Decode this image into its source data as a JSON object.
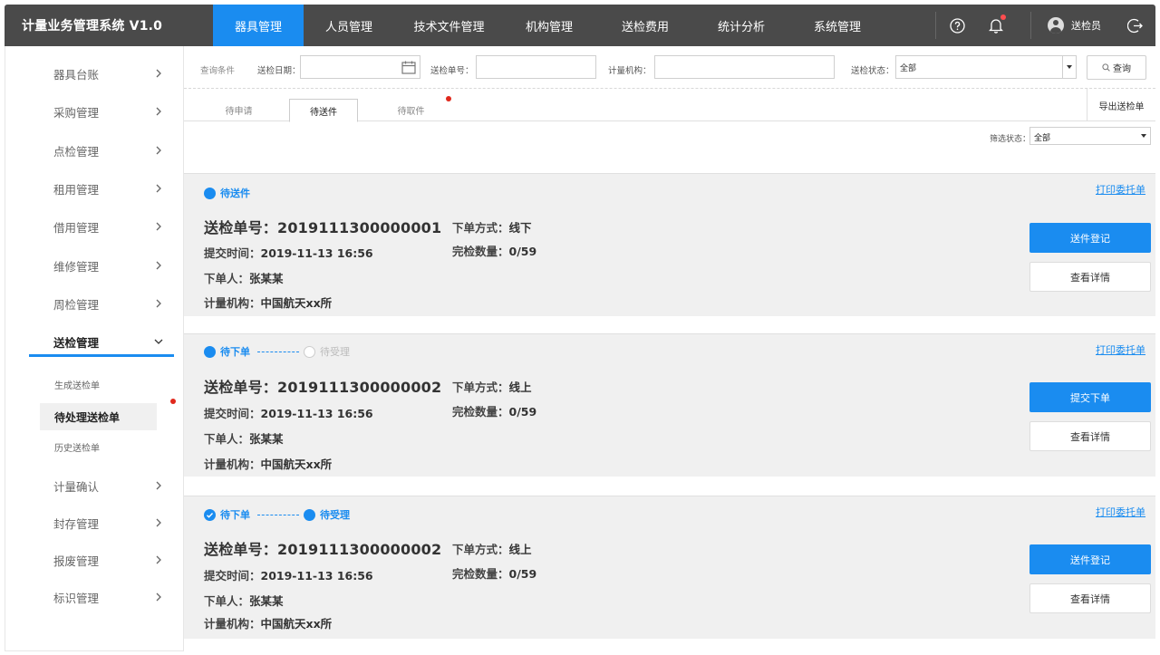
{
  "app": {
    "title": "计量业务管理系统 V1.0"
  },
  "nav": {
    "items": [
      "器具管理",
      "人员管理",
      "技术文件管理",
      "机构管理",
      "送检费用",
      "统计分析",
      "系统管理"
    ],
    "active_index": 0
  },
  "user": {
    "name": "送检员"
  },
  "sidebar": {
    "items": [
      "器具台账",
      "采购管理",
      "点检管理",
      "租用管理",
      "借用管理",
      "维修管理",
      "周检管理",
      "送检管理",
      "计量确认",
      "封存管理",
      "报废管理",
      "标识管理"
    ],
    "open_index": 7,
    "sub_items": [
      "生成送检单",
      "待处理送检单",
      "历史送检单"
    ],
    "active_sub_index": 1
  },
  "filters": {
    "section_label": "查询条件",
    "date_label": "送检日期：",
    "date_value": "",
    "order_no_label": "送检单号：",
    "order_no_value": "",
    "org_label": "计量机构：",
    "org_value": "",
    "status_label": "送检状态：",
    "status_value": "全部",
    "query_button": "查询"
  },
  "tabs": {
    "items": [
      "待申请",
      "待送件",
      "待取件"
    ],
    "active_index": 1,
    "export_button": "导出送检单"
  },
  "filter_status": {
    "label": "筛选状态：",
    "value": "全部"
  },
  "cards": [
    {
      "status_steps": [
        {
          "label": "待送件",
          "state": "active"
        }
      ],
      "print_link": "打印委托单",
      "order_no_label": "送检单号：",
      "order_no": "2019111300000001",
      "submit_label": "提交时间：",
      "submit_time": "2019-11-13 16:56",
      "owner_label": "下单人：",
      "owner": "张某某",
      "org_label": "计量机构：",
      "org": "中国航天xx所",
      "method_label": "下单方式：",
      "method": "线下",
      "count_label": "完检数量：",
      "count": "0/59",
      "primary_button": "送件登记",
      "detail_button": "查看详情"
    },
    {
      "status_steps": [
        {
          "label": "待下单",
          "state": "active"
        },
        {
          "label": "待受理",
          "state": "pending"
        }
      ],
      "print_link": "打印委托单",
      "order_no_label": "送检单号：",
      "order_no": "2019111300000002",
      "submit_label": "提交时间：",
      "submit_time": "2019-11-13 16:56",
      "owner_label": "下单人：",
      "owner": "张某某",
      "org_label": "计量机构：",
      "org": "中国航天xx所",
      "method_label": "下单方式：",
      "method": "线上",
      "count_label": "完检数量：",
      "count": "0/59",
      "primary_button": "提交下单",
      "detail_button": "查看详情"
    },
    {
      "status_steps": [
        {
          "label": "待下单",
          "state": "done"
        },
        {
          "label": "待受理",
          "state": "active"
        }
      ],
      "print_link": "打印委托单",
      "order_no_label": "送检单号：",
      "order_no": "2019111300000002",
      "submit_label": "提交时间：",
      "submit_time": "2019-11-13 16:56",
      "owner_label": "下单人：",
      "owner": "张某某",
      "org_label": "计量机构：",
      "org": "中国航天xx所",
      "method_label": "下单方式：",
      "method": "线上",
      "count_label": "完检数量：",
      "count": "0/59",
      "primary_button": "送件登记",
      "detail_button": "查看详情"
    }
  ],
  "colors": {
    "accent": "#1a8cf0",
    "topbar": "#4a4a4a",
    "card_bg": "#f0f0f0",
    "notify_dot": "#e0281c"
  },
  "icons": [
    "help-icon",
    "bell-icon",
    "user-avatar-icon",
    "logout-icon",
    "calendar-icon",
    "search-icon",
    "chevron-right-icon",
    "chevron-down-icon",
    "check-icon"
  ]
}
